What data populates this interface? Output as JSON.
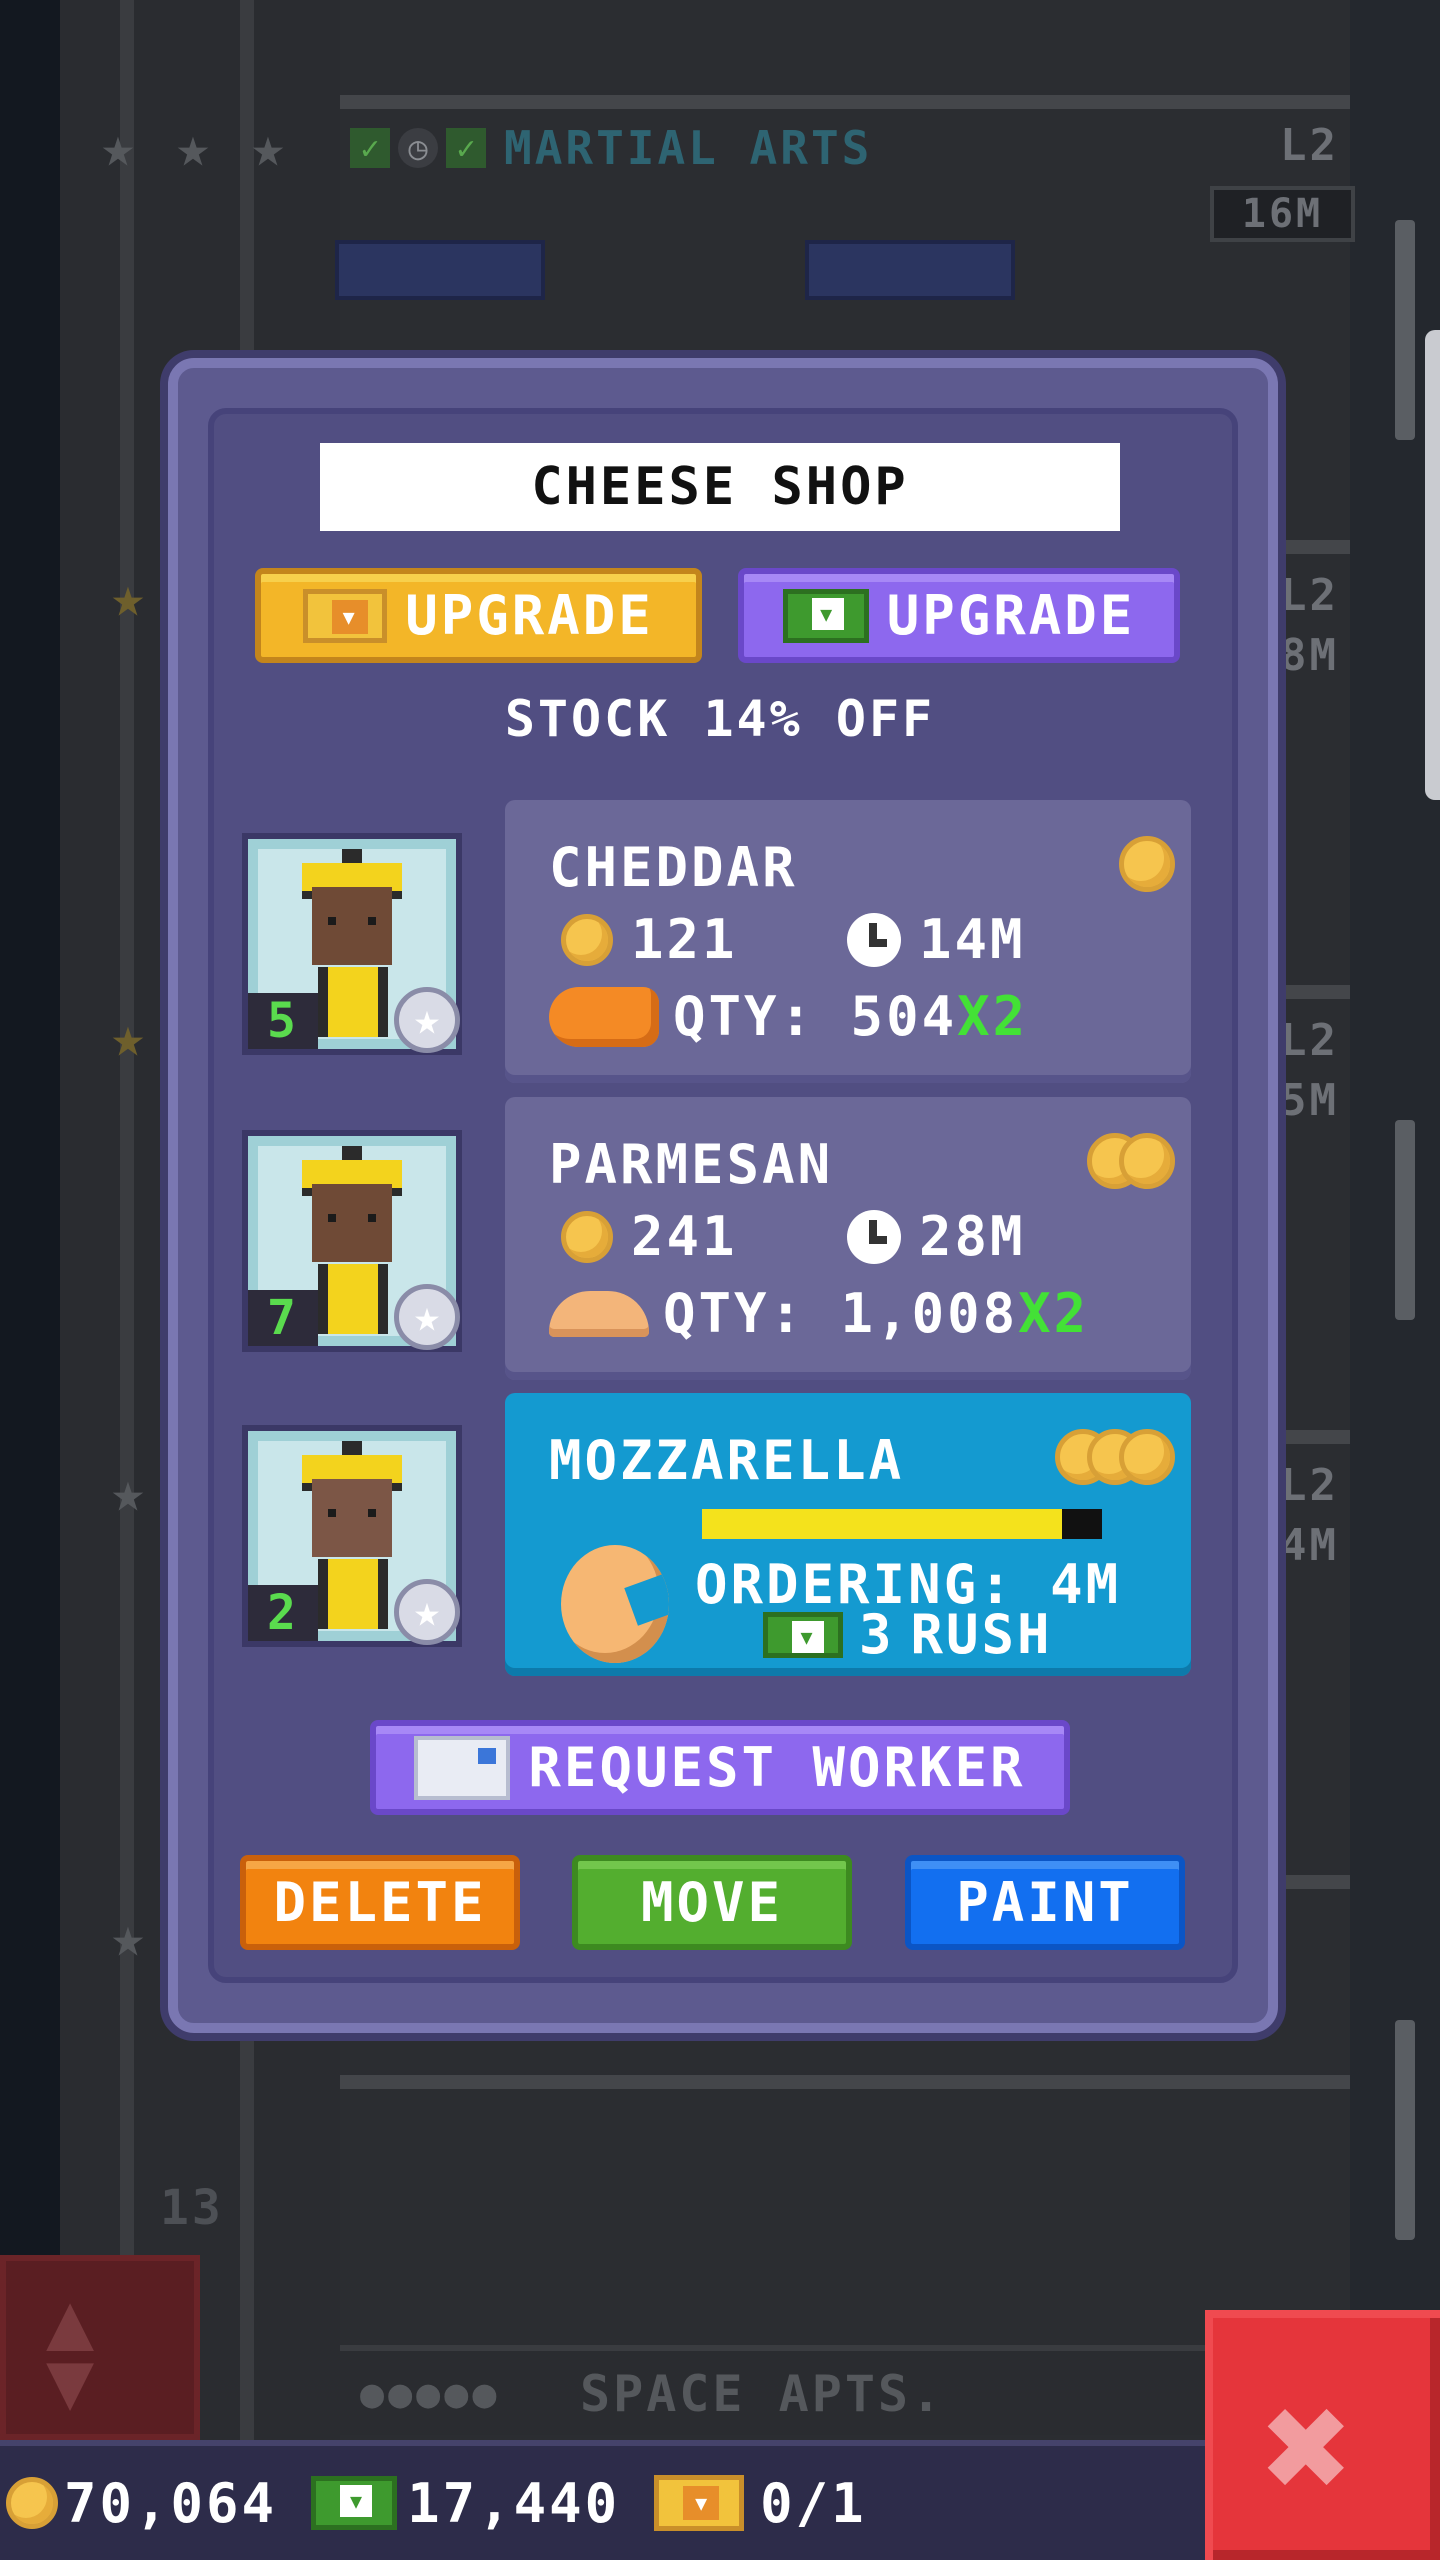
{
  "background": {
    "floor_top": {
      "name": "MARTIAL ARTS",
      "level": "L2",
      "time": "16M"
    },
    "floor_levels": [
      "L2",
      "L2",
      "L2"
    ],
    "floor_times": [
      "8M",
      "5M",
      "4M"
    ],
    "floor_bottom": {
      "name": "SPACE APTS."
    },
    "floor_number": "13"
  },
  "modal": {
    "title": "CHEESE SHOP",
    "upgrade_gold_label": "UPGRADE",
    "upgrade_cash_label": "UPGRADE",
    "discount_text": "STOCK 14% OFF",
    "workers": [
      {
        "level": "5",
        "icon": "star-icon"
      },
      {
        "level": "7",
        "icon": "star-icon"
      },
      {
        "level": "2",
        "icon": "star-icon"
      }
    ],
    "products": [
      {
        "name": "CHEDDAR",
        "tier": 1,
        "cost": "121",
        "time": "14M",
        "qty": "QTY: 504",
        "mult": "X2"
      },
      {
        "name": "PARMESAN",
        "tier": 2,
        "cost": "241",
        "time": "28M",
        "qty": "QTY: 1,008",
        "mult": "X2"
      },
      {
        "name": "MOZZARELLA",
        "tier": 3,
        "status": "ORDERING: 4M",
        "rush_cost": "3",
        "rush_label": "RUSH",
        "progress": 0.9
      }
    ],
    "request_worker_label": "REQUEST WORKER",
    "delete_label": "DELETE",
    "move_label": "MOVE",
    "paint_label": "PAINT"
  },
  "status_bar": {
    "coins": "70,064",
    "bux": "17,440",
    "tickets": "0/1"
  },
  "colors": {
    "accent_purple": "#8d68ee",
    "gold": "#f3b628",
    "delete": "#f2830f",
    "move": "#53ae2f",
    "paint": "#126ff0",
    "active_card": "#149ad0",
    "multiplier": "#43e136"
  }
}
